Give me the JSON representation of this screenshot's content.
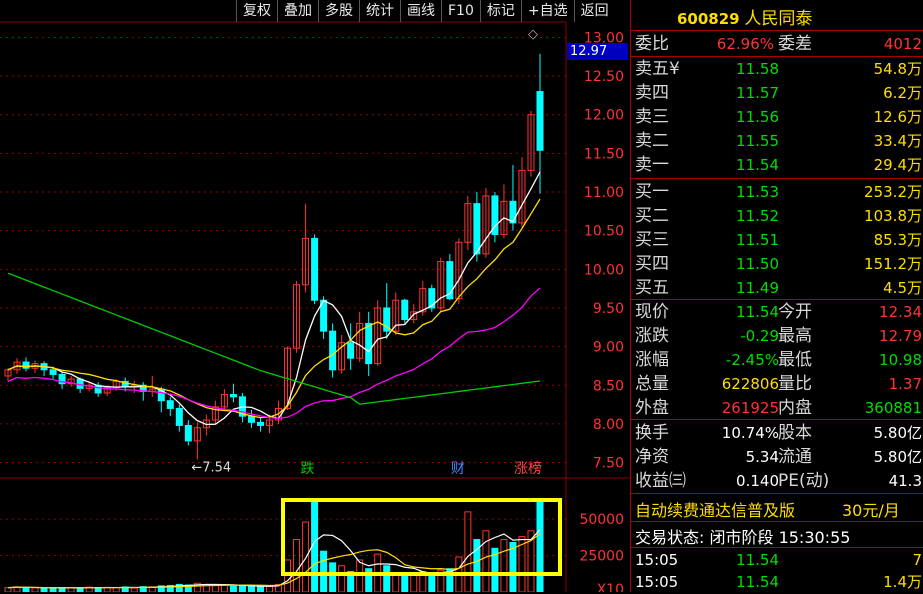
{
  "toolbar": [
    "复权",
    "叠加",
    "多股",
    "统计",
    "画线",
    "F10",
    "标记",
    "+自选",
    "返回"
  ],
  "current_price_badge": "12.97",
  "price_axis": [
    "13.00",
    "12.50",
    "12.00",
    "11.50",
    "11.00",
    "10.50",
    "10.00",
    "9.50",
    "9.00",
    "8.50",
    "8.00",
    "7.50"
  ],
  "volume_axis": [
    "50000",
    "25000",
    "X10"
  ],
  "low_marker": "←7.54",
  "event_tags": [
    {
      "text": "跌",
      "color": "#00cc00"
    },
    {
      "text": "财",
      "color": "#4488ff"
    },
    {
      "text": "涨榜",
      "color": "#ff4444"
    }
  ],
  "quote": {
    "code": "600829",
    "name": "人民同泰",
    "weibi": {
      "label": "委比",
      "value": "62.96%",
      "label2": "委差",
      "value2": "4012"
    },
    "asks": [
      {
        "label": "卖五¥",
        "price": "11.58",
        "vol": "54.8万"
      },
      {
        "label": "卖四",
        "price": "11.57",
        "vol": "6.2万"
      },
      {
        "label": "卖三",
        "price": "11.56",
        "vol": "12.6万"
      },
      {
        "label": "卖二",
        "price": "11.55",
        "vol": "33.4万"
      },
      {
        "label": "卖一",
        "price": "11.54",
        "vol": "29.4万"
      }
    ],
    "bids": [
      {
        "label": "买一",
        "price": "11.53",
        "vol": "253.2万"
      },
      {
        "label": "买二",
        "price": "11.52",
        "vol": "103.8万"
      },
      {
        "label": "买三",
        "price": "11.51",
        "vol": "85.3万"
      },
      {
        "label": "买四",
        "price": "11.50",
        "vol": "151.2万"
      },
      {
        "label": "买五",
        "price": "11.49",
        "vol": "4.5万"
      }
    ],
    "stats": [
      {
        "l1": "现价",
        "v1": "11.54",
        "c1": "#00dd00",
        "l2": "今开",
        "v2": "12.34",
        "c2": "#ff3333"
      },
      {
        "l1": "涨跌",
        "v1": "-0.29",
        "c1": "#00dd00",
        "l2": "最高",
        "v2": "12.79",
        "c2": "#ff3333"
      },
      {
        "l1": "涨幅",
        "v1": "-2.45%",
        "c1": "#00dd00",
        "l2": "最低",
        "v2": "10.98",
        "c2": "#00dd00"
      },
      {
        "l1": "总量",
        "v1": "622806",
        "c1": "#ffdd00",
        "l2": "量比",
        "v2": "1.37",
        "c2": "#ff3333"
      },
      {
        "l1": "外盘",
        "v1": "261925",
        "c1": "#ff3333",
        "l2": "内盘",
        "v2": "360881",
        "c2": "#00dd00"
      }
    ],
    "stats2": [
      {
        "l1": "换手",
        "v1": "10.74%",
        "c1": "#ffffff",
        "l2": "股本",
        "v2": "5.80亿",
        "c2": "#ffffff"
      },
      {
        "l1": "净资",
        "v1": "5.34",
        "c1": "#ffffff",
        "l2": "流通",
        "v2": "5.80亿",
        "c2": "#ffffff"
      },
      {
        "l1": "收益㈢",
        "v1": "0.140",
        "c1": "#ffffff",
        "l2": "PE(动)",
        "v2": "41.3",
        "c2": "#ffffff"
      }
    ],
    "ad_text": "自动续费通达信普及版",
    "ad_price": "30元/月",
    "trade_status": "交易状态: 闭市阶段 15:30:55",
    "ticks": [
      {
        "time": "15:05",
        "price": "11.54",
        "vol": "7"
      },
      {
        "time": "15:05",
        "price": "11.54",
        "vol": "1.4万"
      }
    ]
  },
  "colors": {
    "up": "#ff3333",
    "down": "#00ffff",
    "ma5": "#ffffff",
    "ma10": "#ffdd00",
    "ma20": "#ff00ff",
    "ma60": "#00cc00",
    "grid": "#8b0000",
    "highlight": "#ffff00"
  },
  "chart_data": {
    "type": "candlestick",
    "y_range": [
      7.3,
      13.2
    ],
    "volume_range": [
      0,
      70000
    ],
    "candles": [
      [
        8.62,
        8.7,
        8.55,
        8.72
      ],
      [
        8.7,
        8.8,
        8.65,
        8.85
      ],
      [
        8.8,
        8.72,
        8.68,
        8.86
      ],
      [
        8.72,
        8.78,
        8.66,
        8.82
      ],
      [
        8.78,
        8.7,
        8.62,
        8.81
      ],
      [
        8.7,
        8.64,
        8.58,
        8.74
      ],
      [
        8.64,
        8.52,
        8.45,
        8.67
      ],
      [
        8.52,
        8.58,
        8.48,
        8.62
      ],
      [
        8.58,
        8.46,
        8.4,
        8.6
      ],
      [
        8.46,
        8.5,
        8.42,
        8.55
      ],
      [
        8.5,
        8.4,
        8.35,
        8.54
      ],
      [
        8.4,
        8.47,
        8.36,
        8.5
      ],
      [
        8.47,
        8.55,
        8.43,
        8.58
      ],
      [
        8.55,
        8.48,
        8.42,
        8.6
      ],
      [
        8.48,
        8.5,
        8.4,
        8.56
      ],
      [
        8.5,
        8.42,
        8.3,
        8.54
      ],
      [
        8.42,
        8.45,
        8.35,
        8.62
      ],
      [
        8.45,
        8.3,
        8.15,
        8.48
      ],
      [
        8.3,
        8.2,
        8.1,
        8.35
      ],
      [
        8.2,
        7.98,
        7.9,
        8.25
      ],
      [
        7.98,
        7.78,
        7.72,
        8.05
      ],
      [
        7.78,
        7.95,
        7.54,
        8.02
      ],
      [
        7.95,
        8.05,
        7.85,
        8.12
      ],
      [
        8.05,
        8.22,
        8.0,
        8.3
      ],
      [
        8.22,
        8.38,
        8.18,
        8.45
      ],
      [
        8.38,
        8.35,
        8.28,
        8.52
      ],
      [
        8.35,
        8.1,
        8.02,
        8.4
      ],
      [
        8.1,
        8.02,
        7.95,
        8.18
      ],
      [
        8.02,
        7.98,
        7.9,
        8.08
      ],
      [
        7.98,
        8.05,
        7.88,
        8.12
      ],
      [
        8.05,
        8.2,
        8.0,
        8.3
      ],
      [
        8.2,
        8.98,
        8.18,
        9.0
      ],
      [
        8.98,
        9.8,
        8.92,
        9.85
      ],
      [
        9.8,
        10.4,
        9.7,
        10.85
      ],
      [
        10.4,
        9.6,
        9.55,
        10.45
      ],
      [
        9.6,
        9.2,
        9.1,
        9.65
      ],
      [
        9.2,
        8.7,
        8.6,
        9.3
      ],
      [
        8.7,
        9.05,
        8.65,
        9.15
      ],
      [
        9.05,
        8.85,
        8.7,
        9.3
      ],
      [
        8.85,
        9.3,
        8.8,
        9.45
      ],
      [
        9.3,
        8.78,
        8.62,
        9.45
      ],
      [
        8.78,
        9.5,
        8.75,
        9.6
      ],
      [
        9.5,
        9.2,
        9.1,
        9.82
      ],
      [
        9.2,
        9.6,
        9.15,
        9.7
      ],
      [
        9.6,
        9.35,
        9.3,
        9.62
      ],
      [
        9.35,
        9.45,
        9.3,
        9.55
      ],
      [
        9.45,
        9.75,
        9.4,
        9.85
      ],
      [
        9.75,
        9.5,
        9.45,
        9.8
      ],
      [
        9.5,
        10.1,
        9.45,
        10.15
      ],
      [
        10.1,
        9.62,
        9.6,
        10.2
      ],
      [
        9.62,
        10.35,
        9.55,
        10.4
      ],
      [
        10.35,
        10.85,
        10.25,
        10.95
      ],
      [
        10.85,
        10.2,
        10.1,
        11.0
      ],
      [
        10.2,
        10.95,
        10.15,
        11.05
      ],
      [
        10.95,
        10.45,
        10.35,
        11.0
      ],
      [
        10.45,
        10.88,
        10.4,
        11.1
      ],
      [
        10.88,
        10.6,
        10.5,
        11.35
      ],
      [
        10.6,
        11.28,
        10.55,
        11.45
      ],
      [
        11.28,
        12.0,
        11.2,
        12.05
      ],
      [
        12.3,
        11.54,
        10.98,
        12.79
      ]
    ],
    "volume": [
      3000,
      3500,
      3200,
      2800,
      2600,
      3000,
      2900,
      3100,
      2700,
      3300,
      2900,
      3200,
      3100,
      3400,
      2800,
      3600,
      3500,
      4200,
      4500,
      5200,
      4800,
      6000,
      5200,
      4800,
      4500,
      4000,
      4200,
      3800,
      3600,
      4000,
      5200,
      22000,
      36000,
      48000,
      62000,
      28000,
      20000,
      18000,
      14000,
      22000,
      16000,
      26000,
      18000,
      12000,
      13000,
      12500,
      14000,
      12000,
      15000,
      16000,
      24000,
      55000,
      36000,
      42000,
      30000,
      36000,
      34000,
      38000,
      42000,
      64000
    ],
    "volume_up": [
      1,
      1,
      0,
      1,
      0,
      0,
      0,
      1,
      0,
      1,
      0,
      1,
      1,
      0,
      1,
      0,
      1,
      0,
      0,
      0,
      0,
      1,
      1,
      1,
      1,
      0,
      0,
      0,
      0,
      1,
      1,
      1,
      1,
      1,
      0,
      0,
      0,
      1,
      0,
      1,
      0,
      1,
      0,
      1,
      0,
      1,
      1,
      0,
      1,
      0,
      1,
      1,
      0,
      1,
      0,
      1,
      0,
      1,
      1,
      0
    ]
  }
}
